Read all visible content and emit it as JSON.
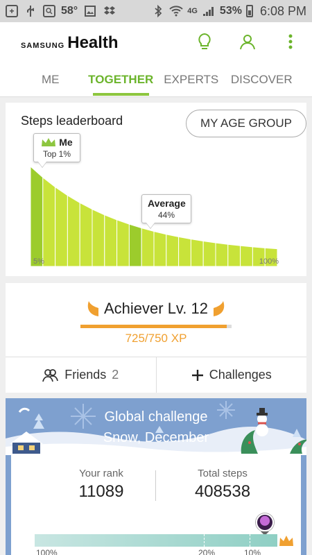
{
  "status_bar": {
    "temperature": "58°",
    "network": "4G",
    "battery": "53%",
    "time": "6:08 PM"
  },
  "header": {
    "brand_prefix": "SAMSUNG",
    "brand_name": "Health"
  },
  "tabs": [
    {
      "label": "ME",
      "active": false
    },
    {
      "label": "TOGETHER",
      "active": true
    },
    {
      "label": "EXPERTS",
      "active": false
    },
    {
      "label": "DISCOVER",
      "active": false
    }
  ],
  "leaderboard": {
    "title": "Steps leaderboard",
    "age_group_button": "MY AGE GROUP",
    "me_label": "Me",
    "me_value": "Top 1%",
    "average_label": "Average",
    "average_value": "44%",
    "left_label": "5%",
    "right_label": "100%"
  },
  "chart_data": {
    "type": "area",
    "x_labels": [
      "5%",
      "100%"
    ],
    "bars": 20,
    "me_percentile": 1,
    "average_percentile": 44,
    "colors": {
      "fill": "#c8e33a",
      "highlight": "#9ccc2c"
    }
  },
  "achiever": {
    "title": "Achiever Lv. 12",
    "xp_text": "725/750 XP",
    "xp_fraction": 0.9667,
    "friends_label": "Friends",
    "friends_count": "2",
    "challenges_label": "Challenges"
  },
  "global_challenge": {
    "title": "Global challenge",
    "subtitle": "Snow, December",
    "rank_label": "Your rank",
    "rank_value": "11089",
    "steps_label": "Total steps",
    "steps_value": "408538",
    "scale_labels": [
      "100%",
      "20%",
      "10%"
    ]
  }
}
